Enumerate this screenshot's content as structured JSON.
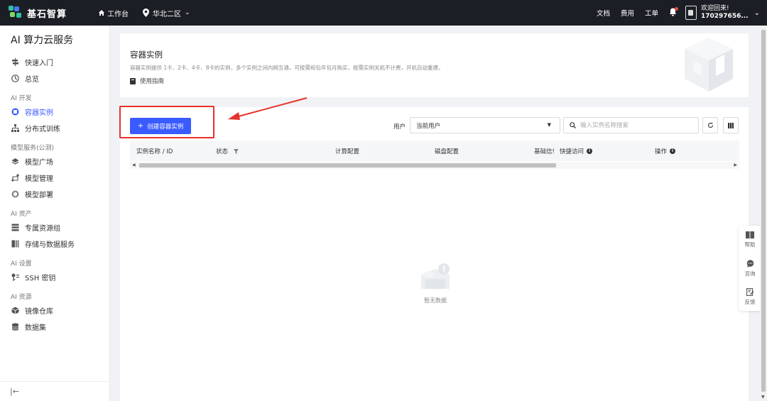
{
  "topbar": {
    "brand": "基石智算",
    "workbench": "工作台",
    "region": "华北二区",
    "links": [
      "文档",
      "费用",
      "工单"
    ],
    "welcome": "欢迎回来!",
    "user_id": "170297656..."
  },
  "sidebar": {
    "title": "AI 算力云服务",
    "top_items": [
      {
        "label": "快速入门",
        "icon": "signpost-icon"
      },
      {
        "label": "总览",
        "icon": "dashboard-icon"
      }
    ],
    "groups": [
      {
        "label": "AI 开发",
        "items": [
          {
            "label": "容器实例",
            "icon": "container-icon",
            "active": true
          },
          {
            "label": "分布式训练",
            "icon": "hierarchy-icon"
          }
        ]
      },
      {
        "label": "模型服务(公测)",
        "items": [
          {
            "label": "模型广场",
            "icon": "layers-icon"
          },
          {
            "label": "模型管理",
            "icon": "model-manage-icon"
          },
          {
            "label": "模型部署",
            "icon": "deploy-icon"
          }
        ]
      },
      {
        "label": "AI 资产",
        "items": [
          {
            "label": "专属资源组",
            "icon": "server-icon"
          },
          {
            "label": "存储与数据服务",
            "icon": "storage-icon"
          }
        ]
      },
      {
        "label": "AI 设置",
        "items": [
          {
            "label": "SSH 密钥",
            "icon": "key-icon"
          }
        ]
      },
      {
        "label": "AI 资源",
        "items": [
          {
            "label": "镜像仓库",
            "icon": "cube-icon"
          },
          {
            "label": "数据集",
            "icon": "database-icon"
          }
        ]
      }
    ],
    "collapse_glyph": "|←"
  },
  "header": {
    "title": "容器实例",
    "description": "容器实例提供 1卡、2卡、4卡、8卡的实例，多个实例之间内网互通，可按需和包年包月购买，按需实例关机不计费，开机自动重建。",
    "guide_link": "使用指南"
  },
  "toolbar": {
    "create_label": "创建容器实例",
    "create_plus": "+",
    "user_label": "用户",
    "user_select_value": "当前用户",
    "search_placeholder": "输入实例名称搜索"
  },
  "table": {
    "columns": [
      "实例名称 / ID",
      "状态",
      "计算配置",
      "磁盘配置",
      "基础信!",
      "快捷访问",
      "操作"
    ]
  },
  "empty": {
    "text": "暂无数据"
  },
  "float_panel": {
    "items": [
      "帮助",
      "咨询",
      "反馈"
    ]
  },
  "colors": {
    "accent": "#3a5bff",
    "topbar_bg": "#1b1e24",
    "highlight": "#e8322c"
  }
}
